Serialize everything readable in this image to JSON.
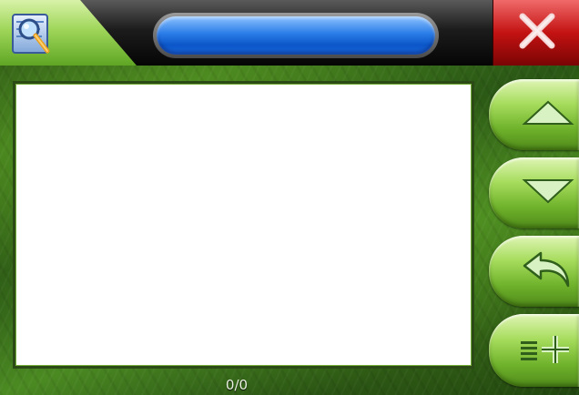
{
  "topbar": {
    "title": "",
    "app_icon": "magnifier-map-icon",
    "close_icon": "close-x-icon",
    "colors": {
      "title_pill": "#1a6ae0",
      "close": "#c41212",
      "app_tab": "#9fd65a"
    }
  },
  "list": {
    "items": []
  },
  "buttons": [
    {
      "name": "scroll-up",
      "icon": "triangle-up-icon"
    },
    {
      "name": "scroll-down",
      "icon": "triangle-down-icon"
    },
    {
      "name": "back",
      "icon": "back-arrow-icon"
    },
    {
      "name": "add-to-list",
      "icon": "list-plus-icon"
    }
  ],
  "status": {
    "counter": "0/0"
  }
}
